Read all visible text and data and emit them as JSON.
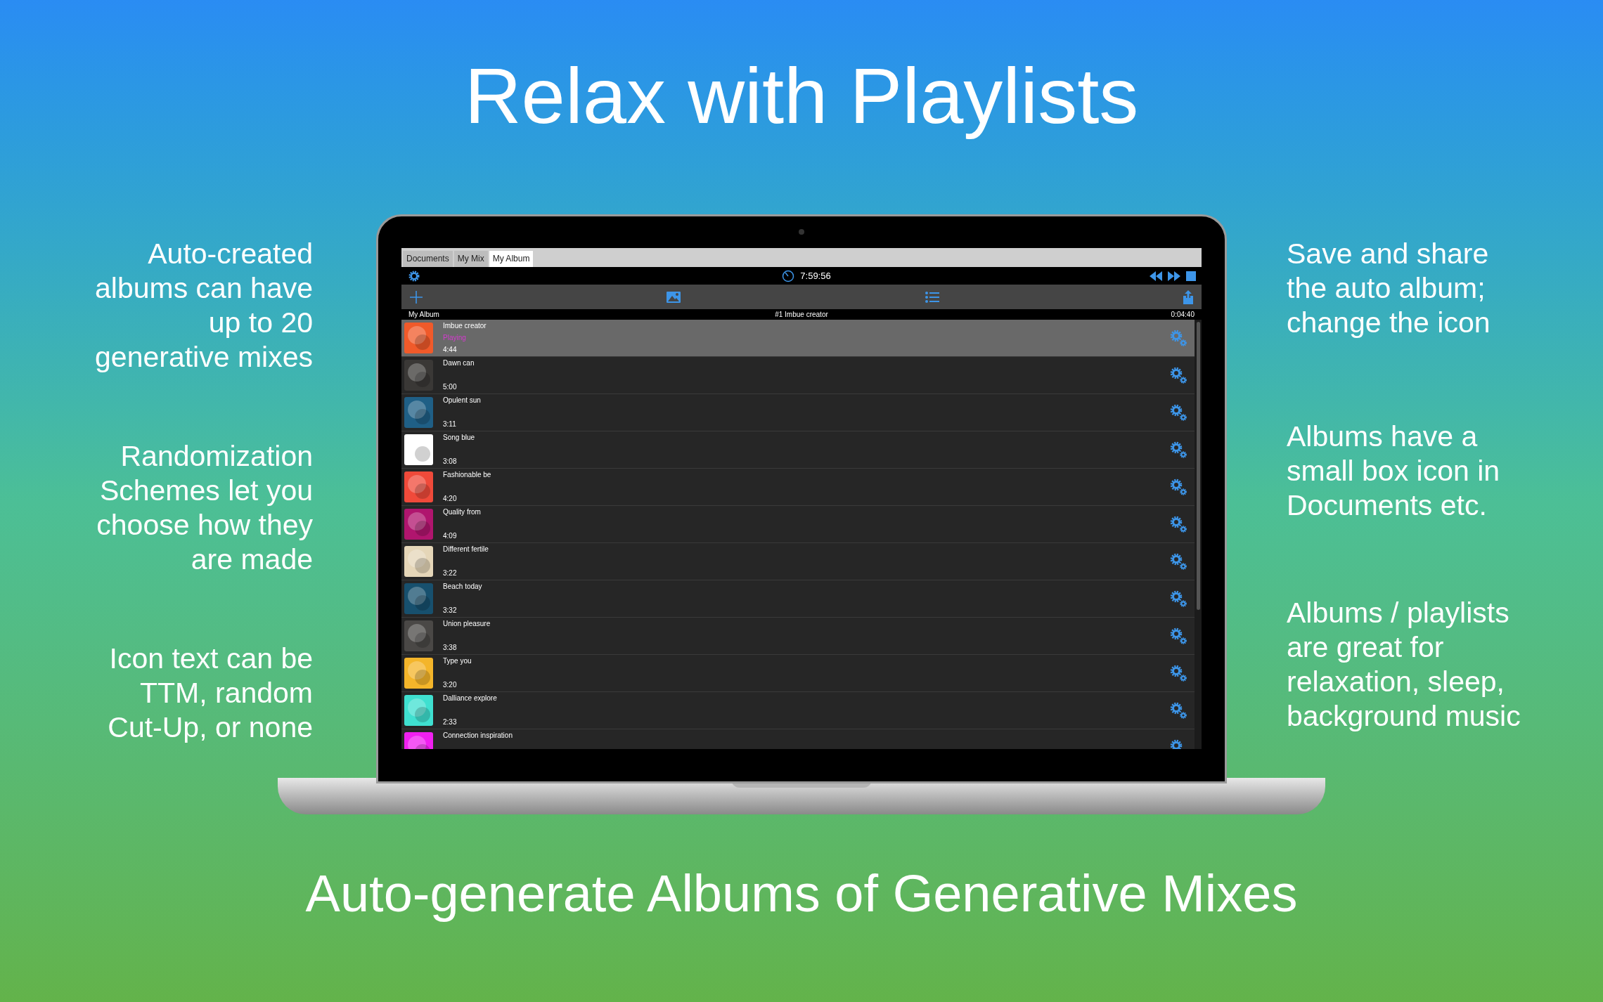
{
  "headline": "Relax with Playlists",
  "left_notes": [
    {
      "lines": [
        "Auto-created",
        "albums can have",
        "up to 20",
        "generative mixes"
      ]
    },
    {
      "lines": [
        "Randomization",
        "Schemes let you",
        "choose how they",
        "are made"
      ]
    },
    {
      "lines": [
        "Icon text can be",
        "TTM, random",
        "Cut-Up, or none"
      ]
    }
  ],
  "right_notes": [
    {
      "lines": [
        "Save and share",
        "the auto album;",
        "change the icon"
      ]
    },
    {
      "lines": [
        "Albums have a",
        "small box icon in",
        "Documents  etc."
      ]
    },
    {
      "lines": [
        "Albums / playlists",
        "are great for",
        "relaxation, sleep,",
        "background music"
      ]
    }
  ],
  "app": {
    "tabs": [
      {
        "label": "Documents",
        "selected": false
      },
      {
        "label": "My Mix",
        "selected": false
      },
      {
        "label": "My Album",
        "selected": true
      }
    ],
    "timer": "7:59:56",
    "header": {
      "album": "My Album",
      "now_playing": "#1 Imbue creator",
      "elapsed": "0:04:40"
    },
    "tracks": [
      {
        "title": "Imbue creator",
        "status": "Playing",
        "duration": "4:44",
        "selected": true,
        "color": "#f05a2a"
      },
      {
        "title": "Dawn can",
        "duration": "5:00",
        "selected": false,
        "color": "#3a3836"
      },
      {
        "title": "Opulent sun",
        "duration": "3:11",
        "selected": false,
        "color": "#1f5f86"
      },
      {
        "title": "Song blue",
        "duration": "3:08",
        "selected": false,
        "color": "#ffffff"
      },
      {
        "title": "Fashionable be",
        "duration": "4:20",
        "selected": false,
        "color": "#f04a3a"
      },
      {
        "title": "Quality from",
        "duration": "4:09",
        "selected": false,
        "color": "#b0156e"
      },
      {
        "title": "Different fertile",
        "duration": "3:22",
        "selected": false,
        "color": "#e5d6b8"
      },
      {
        "title": "Beach today",
        "duration": "3:32",
        "selected": false,
        "color": "#17506e"
      },
      {
        "title": "Union pleasure",
        "duration": "3:38",
        "selected": false,
        "color": "#4a4846"
      },
      {
        "title": "Type you",
        "duration": "3:20",
        "selected": false,
        "color": "#f4b52a"
      },
      {
        "title": "Dalliance explore",
        "duration": "2:33",
        "selected": false,
        "color": "#3fe0d0"
      },
      {
        "title": "Connection inspiration",
        "selected": false,
        "color": "#f020f0"
      }
    ]
  },
  "caption": "Auto-generate Albums of Generative Mixes"
}
